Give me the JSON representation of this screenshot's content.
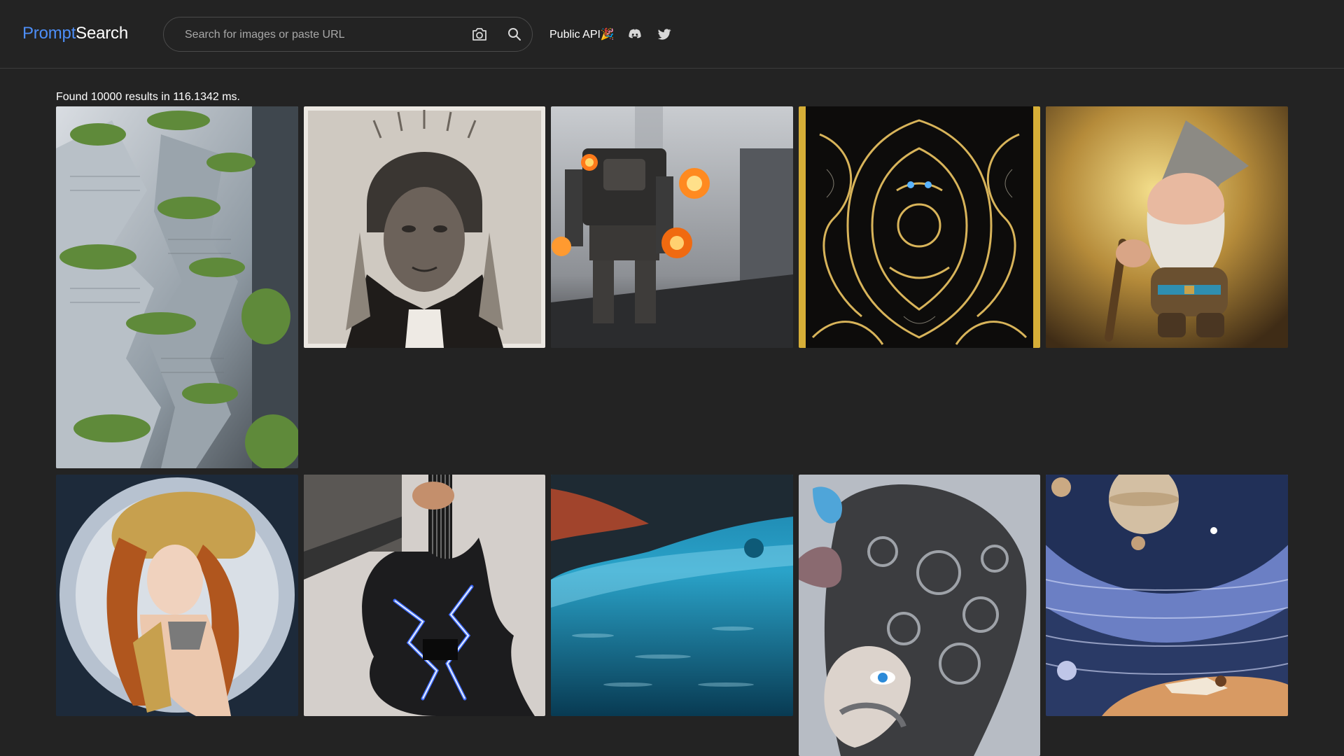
{
  "header": {
    "logo_part1": "Prompt",
    "logo_part2": "Search",
    "search_placeholder": "Search for images or paste URL",
    "camera_icon": "camera-icon",
    "search_icon": "search-icon",
    "api_label": "Public API🎉",
    "discord_icon": "discord-icon",
    "twitter_icon": "twitter-icon"
  },
  "results": {
    "text": "Found 10000 results in 116.1342 ms."
  },
  "gallery": [
    {
      "id": 1,
      "subject": "vertical green city buildings"
    },
    {
      "id": 2,
      "subject": "native american elder portrait"
    },
    {
      "id": 3,
      "subject": "robot walking with explosions"
    },
    {
      "id": 4,
      "subject": "gold and black ornate art"
    },
    {
      "id": 5,
      "subject": "smiling gnome"
    },
    {
      "id": 6,
      "subject": "art nouveau woman with ornate headdress"
    },
    {
      "id": 7,
      "subject": "guitar with blue lightning"
    },
    {
      "id": 8,
      "subject": "underwater scene"
    },
    {
      "id": 9,
      "subject": "biomechanical woman"
    },
    {
      "id": 10,
      "subject": "planets and sleeping figure"
    }
  ],
  "colors": {
    "background": "#232323",
    "accent": "#4d8ef7"
  }
}
